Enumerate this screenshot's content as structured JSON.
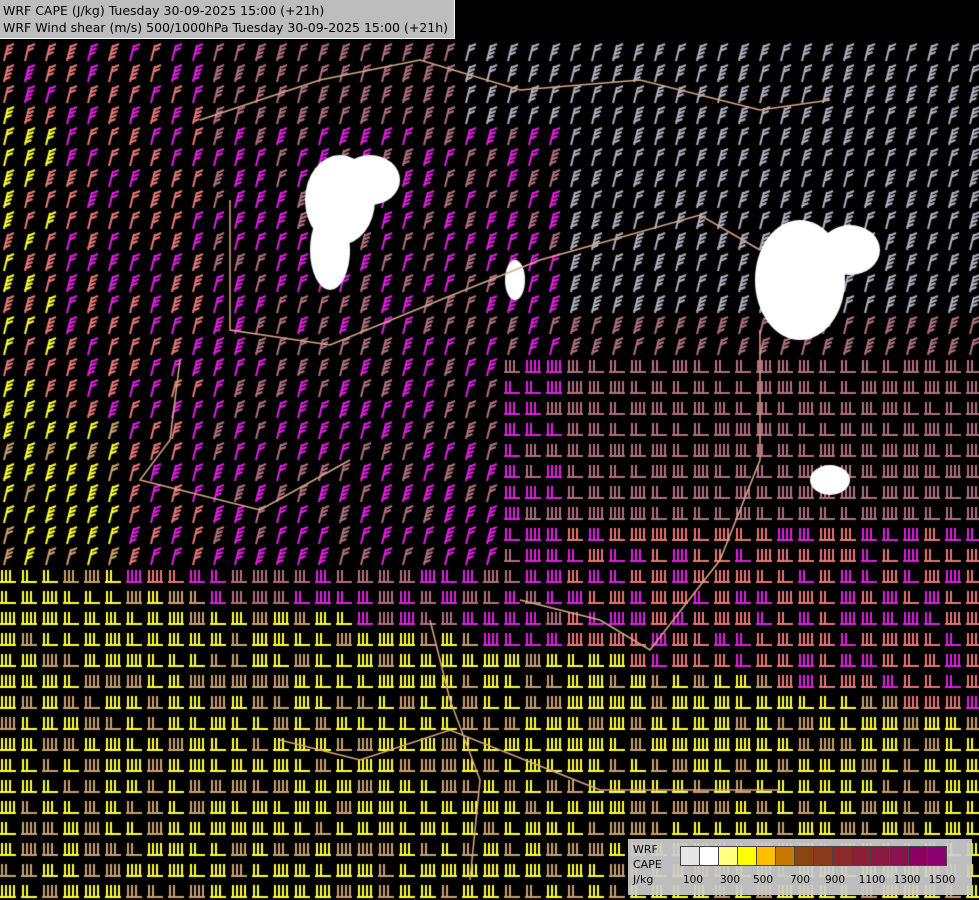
{
  "header": {
    "line1": "WRF CAPE (J/kg) Tuesday 30-09-2025 15:00 (+21h)",
    "line2": "WRF Wind shear (m/s) 500/1000hPa Tuesday 30-09-2025 15:00 (+21h)"
  },
  "legend": {
    "label_line1": "WRF",
    "label_line2": "CAPE",
    "label_line3": "J/kg",
    "tick_labels": [
      "100",
      "300",
      "500",
      "700",
      "900",
      "1100",
      "1300",
      "1500"
    ],
    "swatch_colors": [
      "#e6e6e6",
      "#ffffff",
      "#ffff80",
      "#ffff00",
      "#ffbf00",
      "#c87800",
      "#8b4513",
      "#8b3a1a",
      "#8b2a2a",
      "#8b2035",
      "#8b1a40",
      "#8b1050",
      "#8b0060",
      "#8b0070"
    ]
  },
  "colors": {
    "background": "#000000",
    "barb_yellow": "#ffff33",
    "barb_tan": "#c8a070",
    "barb_salmon": "#e87878",
    "barb_magenta": "#e020e0",
    "barb_mauve": "#b07080",
    "barb_gray": "#b0b0c0",
    "border_line": "#d8a888",
    "cape_patch": "#ffffff"
  }
}
